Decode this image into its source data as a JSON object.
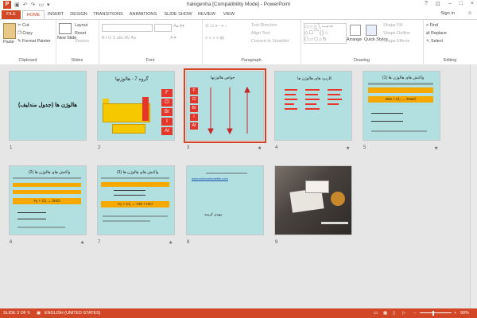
{
  "window": {
    "title": "halogenha [Compatibility Mode] - PowerPoint",
    "app_logo": "P",
    "help": "?",
    "min": "–",
    "max": "□",
    "close": "×",
    "sign_in": "Sign in"
  },
  "quick_access": {
    "undo": "↶",
    "redo": "↷",
    "customize": "▾"
  },
  "tabs": [
    "FILE",
    "HOME",
    "INSERT",
    "DESIGN",
    "TRANSITIONS",
    "ANIMATIONS",
    "SLIDE SHOW",
    "REVIEW",
    "VIEW"
  ],
  "ribbon": {
    "clipboard": {
      "label": "Clipboard",
      "paste": "Paste",
      "cut": "Cut",
      "copy": "Copy",
      "format_painter": "Format Painter"
    },
    "slides": {
      "label": "Slides",
      "new_slide": "New Slide",
      "layout": "Layout",
      "reset": "Reset",
      "section": "Section"
    },
    "font": {
      "label": "Font"
    },
    "paragraph": {
      "label": "Paragraph",
      "text_direction": "Text Direction",
      "align_text": "Align Text",
      "convert_smartart": "Convert to SmartArt"
    },
    "drawing": {
      "label": "Drawing",
      "arrange": "Arrange",
      "quick_styles": "Quick Styles",
      "shape_fill": "Shape Fill",
      "shape_outline": "Shape Outline",
      "shape_effects": "Shape Effects"
    },
    "editing": {
      "label": "Editing",
      "find": "Find",
      "replace": "Replace",
      "select": "Select"
    }
  },
  "slides": [
    {
      "num": "1",
      "title": "هالوژن ها (جدول مندلیف)",
      "star": ""
    },
    {
      "num": "2",
      "title": "گروه 7 - هالوژنها",
      "elements": [
        "F",
        "Cl",
        "Br",
        "I",
        "At"
      ],
      "star": ""
    },
    {
      "num": "3",
      "title": "خواص هالوژنها",
      "elements": [
        "F",
        "Cl",
        "Br",
        "I",
        "At"
      ],
      "star": "★"
    },
    {
      "num": "4",
      "title": "کاربرد های هالوژن ها",
      "star": "★"
    },
    {
      "num": "5",
      "title": "واکنش های هالوژن ها (1)",
      "equation": "2Na + Cl₂ → 2NaCl",
      "star": "★"
    },
    {
      "num": "6",
      "title": "واکنش های هالوژن ها (2)",
      "equation": "H₂ + Cl₂ → 2HCl",
      "star": "★"
    },
    {
      "num": "7",
      "title": "واکنش های هالوژن ها (3)",
      "equation": "H₂ + Cl₂ → HCl + HCl",
      "star": "★"
    },
    {
      "num": "8",
      "title": "مهدی کریمه",
      "link": "www.sciencebenefits.com",
      "star": ""
    },
    {
      "num": "9",
      "title": "",
      "star": ""
    }
  ],
  "status": {
    "slide_of": "SLIDE 3 OF 9",
    "language": "ENGLISH (UNITED STATES)",
    "zoom": "90%"
  },
  "colors": {
    "accent": "#d24726",
    "slide_bg": "#b2dfe0",
    "highlight": "#f5a800",
    "element_red": "#e8352a"
  }
}
